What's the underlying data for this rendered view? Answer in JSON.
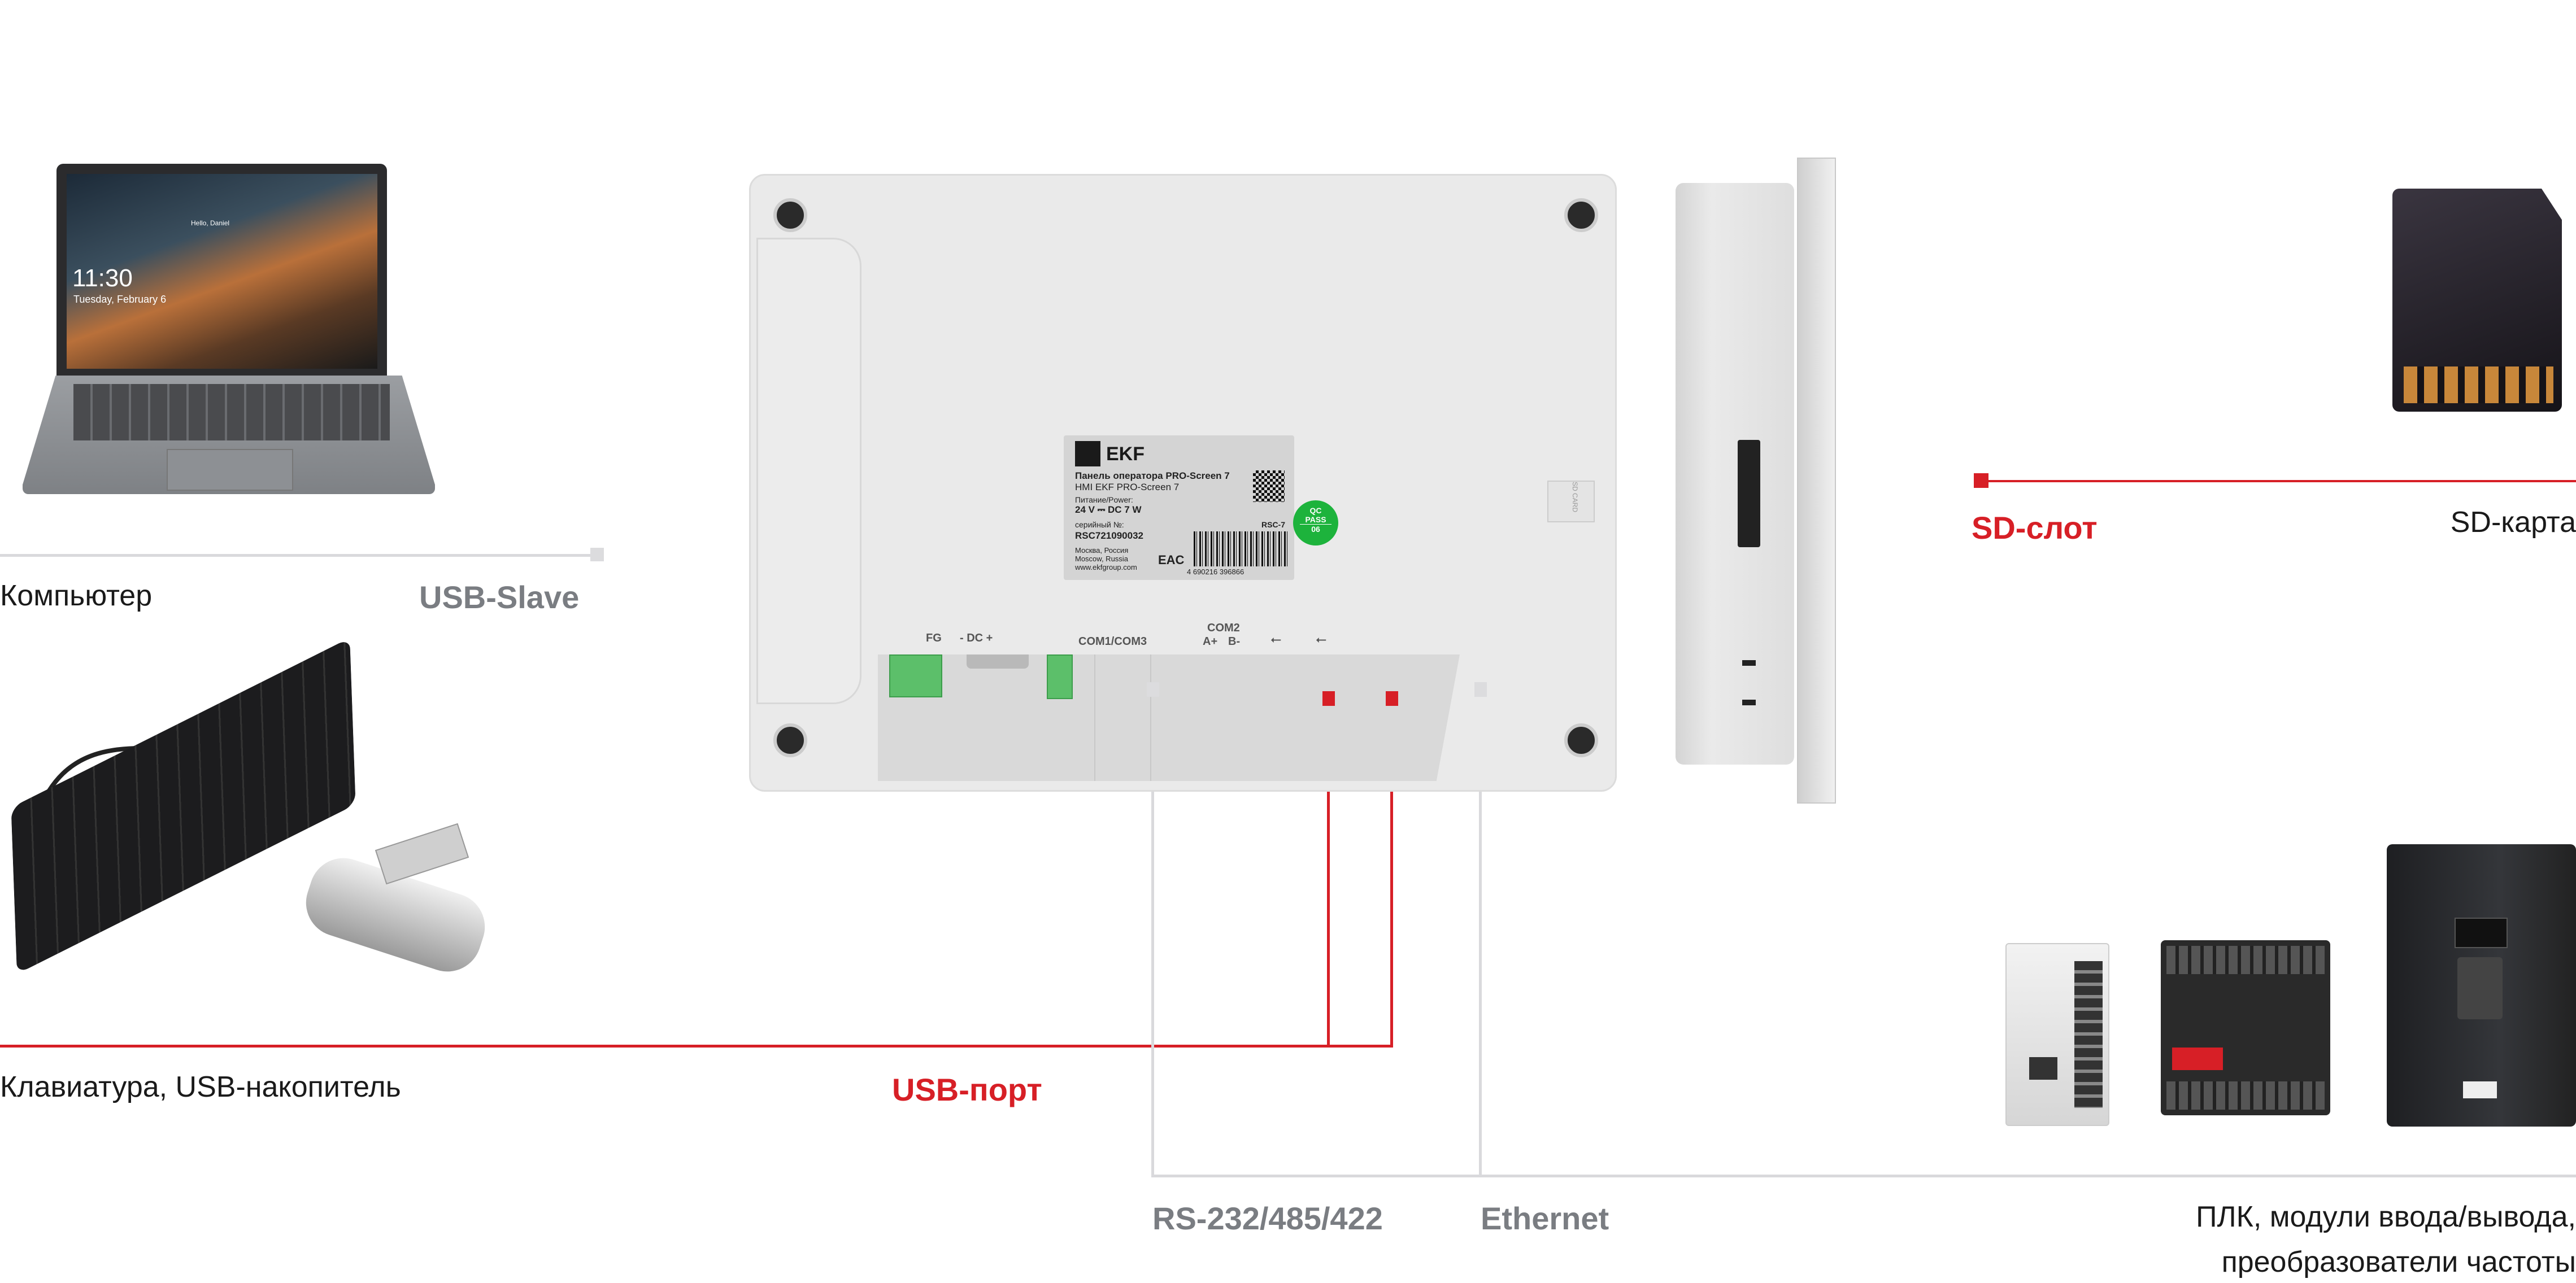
{
  "labels": {
    "computer": "Компьютер",
    "usb_slave": "USB-Slave",
    "keyboard_usb": "Клавиатура,  USB-накопитель",
    "usb_port": "USB-порт",
    "rs": "RS-232/485/422",
    "ethernet": "Ethernet",
    "sd_slot": "SD-слот",
    "sd_card": "SD-карта",
    "plc_line1": "ПЛК, модули ввода/вывода,",
    "plc_line2": "преобразователи частоты"
  },
  "laptop_screen": {
    "greeting": "Hello, Daniel",
    "time": "11:30",
    "date": "Tuesday, February 6"
  },
  "device_label": {
    "brand": "EKF",
    "title_ru": "Панель оператора PRO-Screen 7",
    "title_en": "HMI EKF PRO-Screen 7",
    "power_label": "Питание/Power:",
    "power_value": "24 V ⎓ DC  7 W",
    "serial_label": "серийный №:",
    "serial": "RSC721090032",
    "city_ru": "Москва, Россия",
    "city_en": "Moscow, Russia",
    "website": "www.ekfgroup.com",
    "model": "RSC-7",
    "barcode": "4 690216 396866",
    "eac": "EAC",
    "qc": "QC",
    "qc_pass": "PASS",
    "qc_num": "06"
  },
  "ports": {
    "fg": "FG",
    "dc": "- DC +",
    "com13": "COM1/COM3",
    "com2": "COM2",
    "a": "A+",
    "b": "B-",
    "sd_card": "SD CARD"
  },
  "colors": {
    "accent_red": "#d71f26",
    "line_gray": "#d9d9dc",
    "label_gray": "#7a7d82",
    "terminal_green": "#5cbf6a",
    "qc_green": "#1db33c"
  }
}
